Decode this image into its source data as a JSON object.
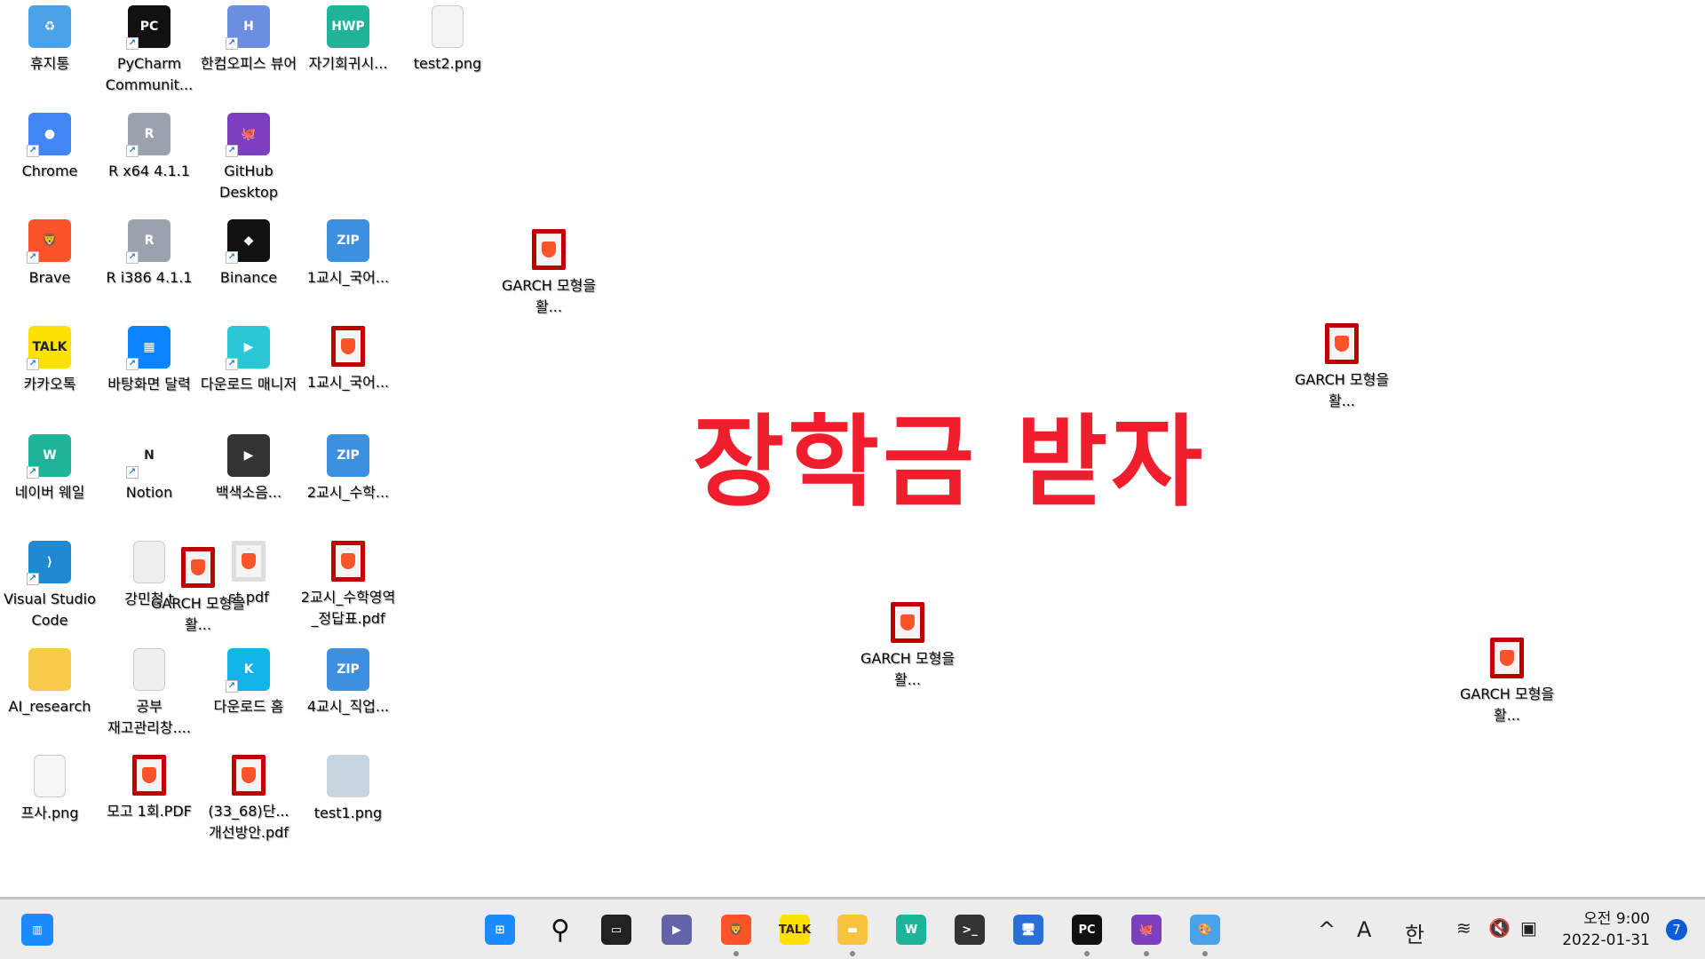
{
  "desktop": {
    "icons": [
      {
        "label": "휴지통",
        "icon": "recycle-bin-icon",
        "color": "#4aa3e8",
        "text": "♻"
      },
      {
        "label": "PyCharm Communit...",
        "icon": "pycharm-icon",
        "color": "#111111",
        "text": "PC"
      },
      {
        "label": "한컴오피스 뷰어",
        "icon": "hancom-viewer-icon",
        "color": "#6a8fe0",
        "text": "H"
      },
      {
        "label": "자기회귀시...",
        "icon": "hwp-file-icon",
        "color": "#1fb39a",
        "text": "HWP"
      },
      {
        "label": "test2.png",
        "icon": "image-file-icon",
        "color": "#f3f3f3",
        "text": ""
      },
      {
        "label": "Chrome",
        "icon": "chrome-icon",
        "color": "#4285f4",
        "text": "●"
      },
      {
        "label": "R x64 4.1.1",
        "icon": "r-icon",
        "color": "#9aa3ad",
        "text": "R"
      },
      {
        "label": "GitHub Desktop",
        "icon": "github-desktop-icon",
        "color": "#7b3fbf",
        "text": "🐙"
      },
      {
        "label": "Brave",
        "icon": "brave-icon",
        "color": "#fb542b",
        "text": "🦁"
      },
      {
        "label": "R i386 4.1.1",
        "icon": "r-icon",
        "color": "#9aa3ad",
        "text": "R"
      },
      {
        "label": "Binance",
        "icon": "binance-icon",
        "color": "#111111",
        "text": "◆"
      },
      {
        "label": "1교시_국어...",
        "icon": "zip-file-icon",
        "color": "#3d8fe0",
        "text": "ZIP"
      },
      {
        "label": "카카오톡",
        "icon": "kakaotalk-icon",
        "color": "#fae100",
        "text": "TALK"
      },
      {
        "label": "바탕화면 달력",
        "icon": "desktop-calendar-icon",
        "color": "#0a84ff",
        "text": "▦"
      },
      {
        "label": "다운로드 매니저",
        "icon": "download-manager-icon",
        "color": "#29c6d6",
        "text": "▶"
      },
      {
        "label": "1교시_국어...",
        "icon": "pdf-file-icon",
        "color": "#c00000",
        "text": ""
      },
      {
        "label": "네이버 웨일",
        "icon": "naver-whale-icon",
        "color": "#1fb39a",
        "text": "W"
      },
      {
        "label": "Notion",
        "icon": "notion-icon",
        "color": "#ffffff",
        "text": "N"
      },
      {
        "label": "백색소음...",
        "icon": "media-file-icon",
        "color": "#333333",
        "text": "▶"
      },
      {
        "label": "2교시_수학...",
        "icon": "zip-file-icon",
        "color": "#3d8fe0",
        "text": "ZIP"
      },
      {
        "label": "Visual Studio Code",
        "icon": "vscode-icon",
        "color": "#1f8ad2",
        "text": "⟩"
      },
      {
        "label": "강민철 t",
        "icon": "text-file-icon",
        "color": "#eeeeee",
        "text": ""
      },
      {
        "label": "st.pdf",
        "icon": "pdf-file-icon",
        "color": "#f4f4f4",
        "text": ""
      },
      {
        "label": "2교시_수학영역_정답표.pdf",
        "icon": "pdf-file-icon",
        "color": "#c00000",
        "text": ""
      },
      {
        "label": "AI_research",
        "icon": "folder-icon",
        "color": "#f8cc4a",
        "text": ""
      },
      {
        "label": "공부 재고관리창....",
        "icon": "text-file-icon",
        "color": "#eeeeee",
        "text": ""
      },
      {
        "label": "다운로드 홈",
        "icon": "download-home-icon",
        "color": "#10b4e8",
        "text": "K"
      },
      {
        "label": "4교시_직업...",
        "icon": "zip-file-icon",
        "color": "#3d8fe0",
        "text": "ZIP"
      },
      {
        "label": "프사.png",
        "icon": "image-file-icon",
        "color": "#f6f6f6",
        "text": ""
      },
      {
        "label": "모고 1회.PDF",
        "icon": "pdf-file-icon",
        "color": "#c00000",
        "text": ""
      },
      {
        "label": "(33_68)단... 개선방안.pdf",
        "icon": "pdf-file-icon",
        "color": "#c00000",
        "text": ""
      },
      {
        "label": "test1.png",
        "icon": "image-file-icon",
        "color": "#c9d6e0",
        "text": ""
      }
    ],
    "floating": [
      {
        "label": "GARCH 모형을 활..."
      },
      {
        "label": "GARCH 모형을 활..."
      },
      {
        "label": "GARCH 모형을 활..."
      },
      {
        "label": "GARCH 모형을 활..."
      },
      {
        "label": "GARCH 모형을 활..."
      }
    ],
    "wallpaper_text": "장학금 받자",
    "wallpaper_text_color": "#f01e2c"
  },
  "taskbar": {
    "apps": [
      {
        "name": "start-button",
        "icon": "windows-icon",
        "text": "⊞",
        "color": "#1a8cff",
        "running": false
      },
      {
        "name": "search-button",
        "icon": "search-icon",
        "text": "⚲",
        "color": "#111",
        "running": false
      },
      {
        "name": "task-view-button",
        "icon": "task-view-icon",
        "text": "▭",
        "color": "#222",
        "running": false
      },
      {
        "name": "chat-button",
        "icon": "teams-chat-icon",
        "text": "▶",
        "color": "#6264a7",
        "running": false
      },
      {
        "name": "brave-taskbar",
        "icon": "brave-icon",
        "text": "🦁",
        "color": "#fb542b",
        "running": true
      },
      {
        "name": "kakaotalk-taskbar",
        "icon": "kakaotalk-icon",
        "text": "TALK",
        "color": "#fae100",
        "running": false
      },
      {
        "name": "file-explorer-taskbar",
        "icon": "folder-icon",
        "text": "▬",
        "color": "#f8c440",
        "running": true
      },
      {
        "name": "whale-taskbar",
        "icon": "naver-whale-icon",
        "text": "W",
        "color": "#1fb39a",
        "running": false
      },
      {
        "name": "terminal-taskbar",
        "icon": "terminal-icon",
        "text": ">_",
        "color": "#333",
        "running": false
      },
      {
        "name": "remote-desktop-taskbar",
        "icon": "remote-desktop-icon",
        "text": "🖥",
        "color": "#2a6fd6",
        "running": false
      },
      {
        "name": "pycharm-taskbar",
        "icon": "pycharm-icon",
        "text": "PC",
        "color": "#111",
        "running": true
      },
      {
        "name": "github-desktop-taskbar",
        "icon": "github-desktop-icon",
        "text": "🐙",
        "color": "#7b3fbf",
        "running": true
      },
      {
        "name": "paint-taskbar",
        "icon": "paint-icon",
        "text": "🎨",
        "color": "#4aa3e8",
        "running": true
      }
    ],
    "tray": {
      "chevron": "^",
      "ime_mode": "A",
      "ime_lang": "한",
      "wifi": "wifi-icon",
      "volume": "volume-muted-icon",
      "battery": "battery-charging-icon"
    },
    "time": "오전 9:00",
    "date": "2022-01-31",
    "notification_count": "7"
  }
}
